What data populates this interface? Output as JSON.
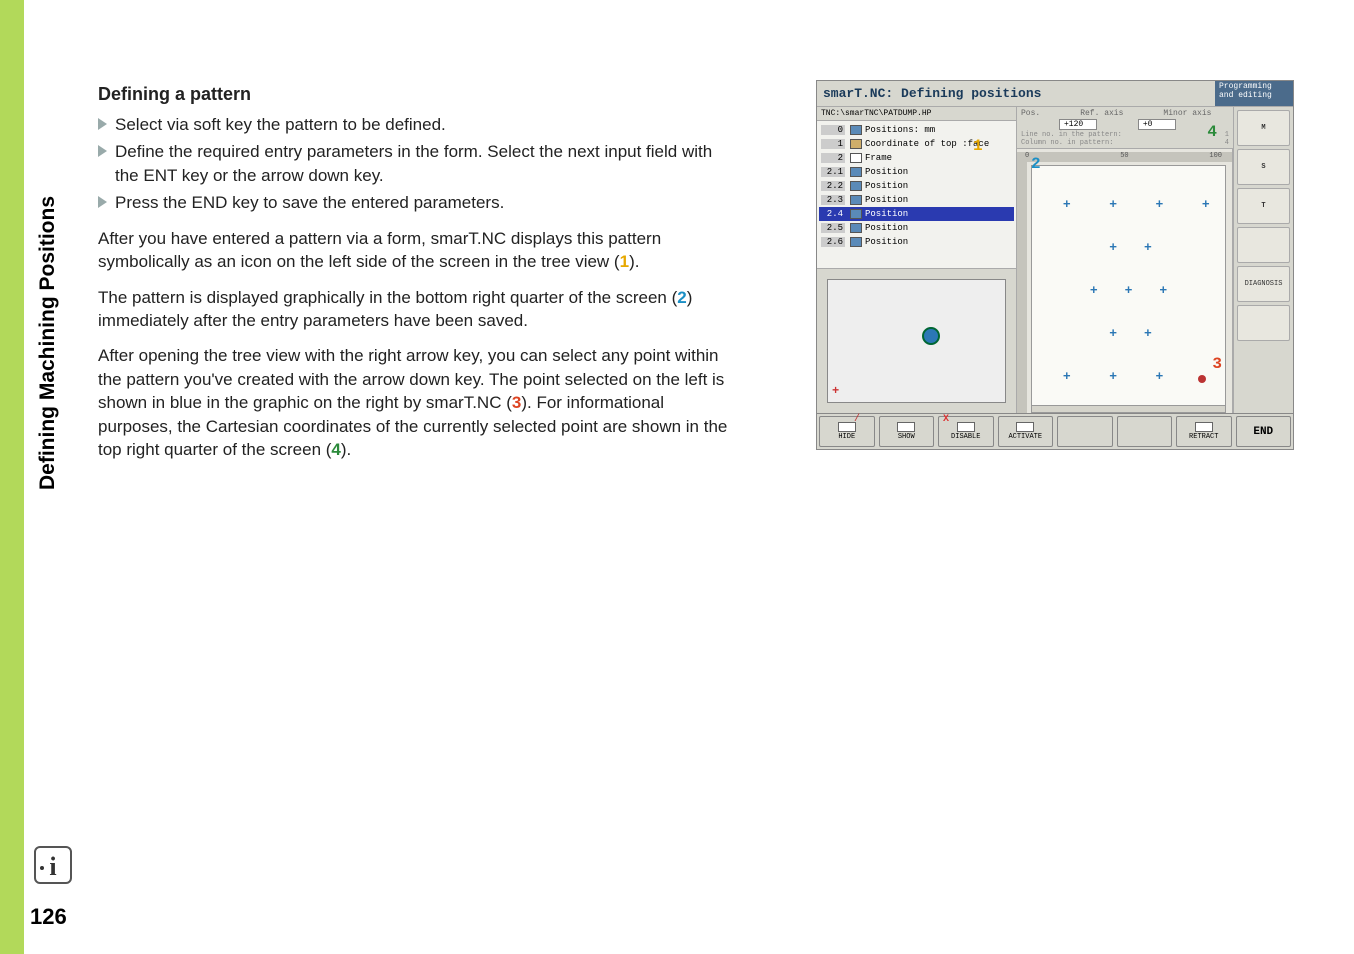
{
  "sidebar_title": "Defining Machining Positions",
  "heading": "Defining a pattern",
  "bullets": [
    "Select via soft key the pattern to be defined.",
    "Define the required entry parameters in the form. Select the next input field with the ENT key or the arrow down key.",
    "Press the END key to save the entered parameters."
  ],
  "para1_a": "After you have entered a pattern via a form, smarT.NC displays this pattern symbolically as an icon on the left side of the screen in the tree view (",
  "para1_c": ").",
  "para2_a": "The pattern is displayed graphically in the bottom right quarter of the screen (",
  "para2_c": ") immediately after the entry parameters have been saved.",
  "para3_a": "After opening the tree view with the right arrow key, you can select any point within the pattern you've created with the arrow down key. The point selected on the left is shown in blue in the graphic on the right by smarT.NC (",
  "para3_c": "). For informational purposes, the Cartesian coordinates of the currently selected point are shown in the top right quarter of the screen (",
  "para3_e": ").",
  "n1": "1",
  "n2": "2",
  "n3": "3",
  "n4": "4",
  "screenshot": {
    "title": "smarT.NC: Defining positions",
    "title_side1": "Programming",
    "title_side2": "and editing",
    "path": "TNC:\\smarTNC\\PATDUMP.HP",
    "tree": [
      {
        "n": "0",
        "t": "Positions: mm",
        "cls": "blue"
      },
      {
        "n": "1",
        "t": "Coordinate of top   :face",
        "cls": ""
      },
      {
        "n": "2",
        "t": "Frame",
        "cls": "frame"
      },
      {
        "n": "2.1",
        "t": "Position",
        "cls": "blue"
      },
      {
        "n": "2.2",
        "t": "Position",
        "cls": "blue"
      },
      {
        "n": "2.3",
        "t": "Position",
        "cls": "blue"
      },
      {
        "n": "2.4",
        "t": "Position",
        "cls": "blue",
        "sel": true
      },
      {
        "n": "2.5",
        "t": "Position",
        "cls": "blue"
      },
      {
        "n": "2.6",
        "t": "Position",
        "cls": "blue"
      }
    ],
    "pos_hdr_labels": {
      "a": "Pos.",
      "b": "Ref. axis",
      "c": "Minor axis"
    },
    "pos_val1": "+120",
    "pos_val2": "+0",
    "pos_note1": "Line no. in the pattern:",
    "pos_note2": "Column no. in pattern:",
    "pos_note_v1": "1",
    "pos_note_v2": "4",
    "ruler_l": "0",
    "ruler_m": "50",
    "ruler_r": "100",
    "sidetabs": [
      "M",
      "S",
      "T",
      "",
      "DIAGNOSIS",
      ""
    ],
    "softkeys": [
      {
        "l1": "",
        "l2": "HIDE"
      },
      {
        "l1": "",
        "l2": "SHOW"
      },
      {
        "l1": "",
        "l2": "DISABLE"
      },
      {
        "l1": "",
        "l2": "ACTIVATE"
      },
      {
        "l1": "",
        "l2": ""
      },
      {
        "l1": "",
        "l2": ""
      },
      {
        "l1": "RETRACT",
        "l2": ""
      },
      {
        "l1": "",
        "l2": "END"
      }
    ]
  },
  "page_number": "126",
  "info_glyph": "i"
}
